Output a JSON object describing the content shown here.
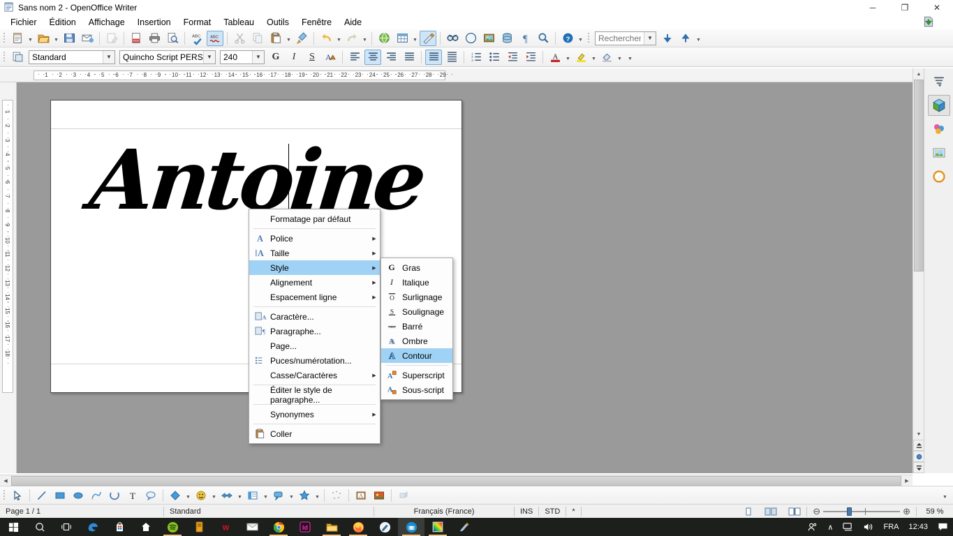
{
  "window": {
    "title": "Sans nom 2 - OpenOffice Writer",
    "minimize": "─",
    "maximize": "❐",
    "close": "✕"
  },
  "menubar": [
    {
      "label": "Fichier",
      "accel": "F"
    },
    {
      "label": "Édition",
      "accel": "É"
    },
    {
      "label": "Affichage",
      "accel": "A"
    },
    {
      "label": "Insertion",
      "accel": "I"
    },
    {
      "label": "Format",
      "accel": "t"
    },
    {
      "label": "Tableau",
      "accel": "b"
    },
    {
      "label": "Outils",
      "accel": "O"
    },
    {
      "label": "Fenêtre",
      "accel": "ê"
    },
    {
      "label": "Aide",
      "accel": "e"
    }
  ],
  "standard_toolbar": {
    "buttons": [
      "new-document-icon",
      "open-document-icon",
      "save-document-icon",
      "email-document-icon",
      "edit-file-icon",
      "export-pdf-icon",
      "print-icon",
      "print-preview-icon",
      "spelling-check-icon",
      "autospellcheck-icon",
      "cut-icon",
      "copy-icon",
      "paste-icon",
      "clone-formatting-icon",
      "undo-icon",
      "redo-icon",
      "hyperlink-icon",
      "table-icon",
      "show-draw-functions-icon",
      "find-replace-icon",
      "navigator-icon",
      "gallery-icon",
      "data-sources-icon",
      "formatting-marks-icon",
      "zoom-icon",
      "help-icon"
    ],
    "search_placeholder": "Rechercher",
    "search_value": "",
    "find-next-icon": "find-next-icon",
    "find-prev-icon": "find-previous-icon"
  },
  "formatting_toolbar": {
    "paragraph_style": "Standard",
    "font_name": "Quincho Script PERSONA",
    "font_size": "240",
    "bold_label": "G",
    "italic_label": "I",
    "underline_label": "S",
    "buttons": [
      "bold-icon",
      "italic-icon",
      "underline-icon",
      "font-color-highlight-icon",
      "align-left-icon",
      "align-center-icon",
      "align-right-icon",
      "align-justified-icon",
      "line-spacing-1-icon",
      "line-spacing-2-icon",
      "ordered-list-icon",
      "unordered-list-icon",
      "decrease-indent-icon",
      "increase-indent-icon",
      "font-color-icon",
      "highlighting-icon",
      "background-color-icon"
    ],
    "active": [
      "align-center-icon",
      "line-spacing-1-icon"
    ]
  },
  "ruler": {
    "horizontal_ticks": [
      "1",
      "2",
      "3",
      "4",
      "5",
      "6",
      "7",
      "8",
      "9",
      "10",
      "11",
      "12",
      "13",
      "14",
      "15",
      "16",
      "17",
      "18",
      "19",
      "20",
      "21",
      "22",
      "23",
      "24",
      "25",
      "26",
      "27",
      "28",
      "29"
    ],
    "vertical_ticks": [
      "1",
      "2",
      "3",
      "4",
      "5",
      "6",
      "7",
      "8",
      "9",
      "10",
      "11",
      "12",
      "13",
      "14",
      "15",
      "16",
      "17",
      "18"
    ]
  },
  "document": {
    "text": "Antoine"
  },
  "context_menu": {
    "items": [
      {
        "label": "Formatage par défaut",
        "accel": "d",
        "icon": "",
        "submenu": false,
        "divider_after": true
      },
      {
        "label": "Police",
        "accel": "P",
        "icon": "font-name-icon",
        "submenu": true,
        "divider_after": false
      },
      {
        "label": "Taille",
        "accel": "T",
        "icon": "font-size-icon",
        "submenu": true,
        "divider_after": false
      },
      {
        "label": "Style",
        "accel": "y",
        "icon": "",
        "submenu": true,
        "divider_after": false,
        "highlighted": true
      },
      {
        "label": "Alignement",
        "accel": "l",
        "icon": "",
        "submenu": true,
        "divider_after": false
      },
      {
        "label": "Espacement ligne",
        "accel": "",
        "icon": "",
        "submenu": true,
        "divider_after": true
      },
      {
        "label": "Caractère...",
        "accel": "a",
        "icon": "character-dialog-icon",
        "submenu": false,
        "divider_after": false
      },
      {
        "label": "Paragraphe...",
        "accel": "a",
        "icon": "paragraph-dialog-icon",
        "submenu": false,
        "divider_after": false
      },
      {
        "label": "Page...",
        "accel": "g",
        "icon": "",
        "submenu": false,
        "divider_after": false
      },
      {
        "label": "Puces/numérotation...",
        "accel": "P",
        "icon": "bullets-numbering-icon",
        "submenu": false,
        "divider_after": false
      },
      {
        "label": "Casse/Caractères",
        "accel": "",
        "icon": "",
        "submenu": true,
        "divider_after": true
      },
      {
        "label": "Éditer le style de paragraphe...",
        "accel": "g",
        "icon": "",
        "submenu": false,
        "divider_after": true
      },
      {
        "label": "Synonymes",
        "accel": "",
        "icon": "",
        "submenu": true,
        "divider_after": true
      },
      {
        "label": "Coller",
        "accel": "ll",
        "icon": "paste-icon",
        "submenu": false,
        "divider_after": false
      }
    ]
  },
  "style_submenu": {
    "items": [
      {
        "label": "Gras",
        "accel": "G",
        "icon": "bold-icon",
        "divider_after": false
      },
      {
        "label": "Italique",
        "accel": "I",
        "icon": "italic-icon",
        "divider_after": false
      },
      {
        "label": "Surlignage",
        "accel": "S",
        "icon": "overline-icon",
        "divider_after": false
      },
      {
        "label": "Soulignage",
        "accel": "l",
        "icon": "underline-icon",
        "divider_after": false
      },
      {
        "label": "Barré",
        "accel": "B",
        "icon": "strikethrough-icon",
        "divider_after": false
      },
      {
        "label": "Ombre",
        "accel": "O",
        "icon": "shadow-icon",
        "divider_after": false
      },
      {
        "label": "Contour",
        "accel": "C",
        "icon": "outline-icon",
        "divider_after": true,
        "highlighted": true
      },
      {
        "label": "Superscript",
        "accel": "",
        "icon": "superscript-icon",
        "divider_after": false
      },
      {
        "label": "Sous-script",
        "accel": "t",
        "icon": "subscript-icon",
        "divider_after": false
      }
    ]
  },
  "drawing_toolbar": {
    "buttons": [
      "select-icon",
      "line-icon",
      "rectangle-icon",
      "ellipse-icon",
      "freeform-line-icon",
      "arc-icon",
      "text-box-icon",
      "callout-icon",
      "basic-shapes-icon",
      "symbol-shapes-icon",
      "block-arrows-icon",
      "flowchart-icon",
      "callout-shapes-icon",
      "stars-icon",
      "points-icon",
      "fontwork-gallery-icon",
      "from-file-icon",
      "extrusion-icon"
    ]
  },
  "statusbar": {
    "page": "Page 1 / 1",
    "page_style": "Standard",
    "language": "Français (France)",
    "insert_mode": "INS",
    "selection_mode": "STD",
    "modified": "*",
    "view_layout": [
      "single-page-view-icon",
      "multi-page-view-icon",
      "book-view-icon"
    ],
    "zoom_out": "⊖",
    "zoom_in": "⊕",
    "zoom": "59 %"
  },
  "sidebar": {
    "items": [
      {
        "name": "sidebar-settings-icon",
        "selected": false
      },
      {
        "name": "properties-panel-icon",
        "selected": true
      },
      {
        "name": "styles-panel-icon",
        "selected": false
      },
      {
        "name": "gallery-panel-icon",
        "selected": false
      },
      {
        "name": "navigator-panel-icon",
        "selected": false
      }
    ]
  },
  "taskbar": {
    "icons": [
      "windows-start-icon",
      "search-icon",
      "task-view-icon",
      "edge-icon",
      "microsoft-store-icon",
      "home-icon",
      "spotify-icon",
      "book-icon",
      "wps-icon",
      "mail-icon",
      "chrome-icon",
      "indesign-icon",
      "file-explorer-icon",
      "firefox-icon",
      "paint-brush-icon",
      "openoffice-icon",
      "color-picker-icon",
      "paint-3d-icon"
    ],
    "tray": {
      "people-icon": "⚬",
      "show-hidden-icon": "∧",
      "network-icon": "network-icon",
      "volume-icon": "volume-icon",
      "language": "FRA",
      "time": "12:43",
      "action-center-icon": "action-center-icon"
    }
  }
}
